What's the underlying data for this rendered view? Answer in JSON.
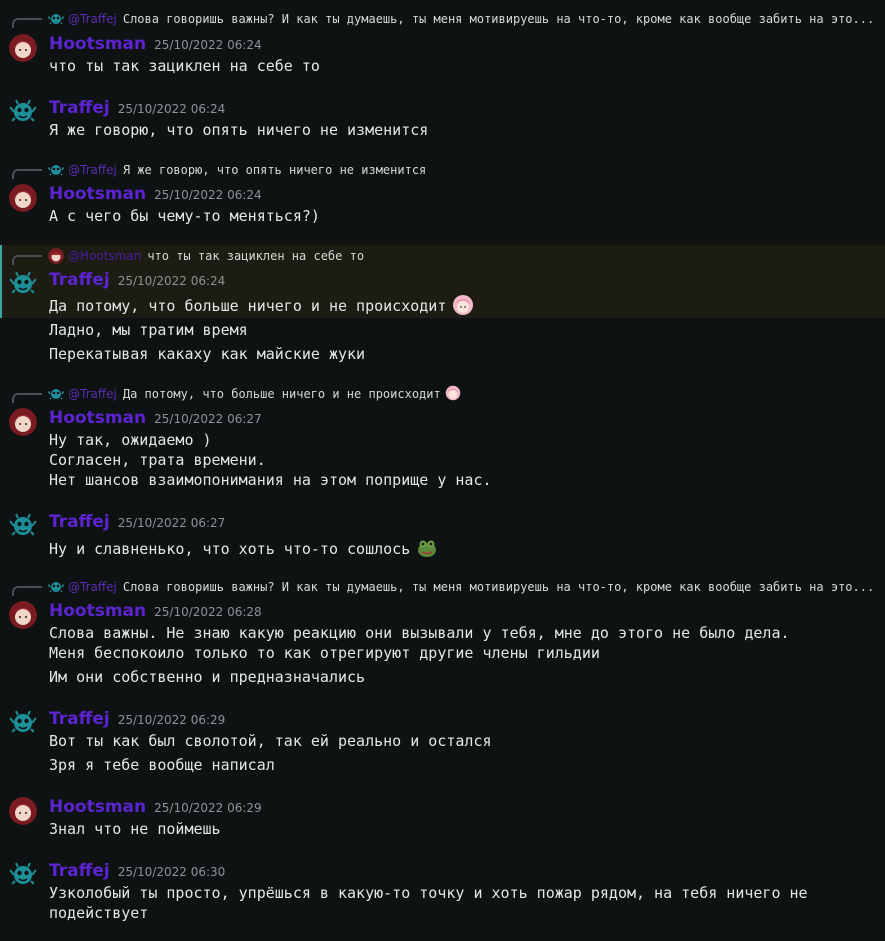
{
  "colors": {
    "background": "#0f1212",
    "username": "#5b24d0",
    "timestamp": "#8e9297",
    "text": "#e4e6e8",
    "highlight_bg": "#1c1c12",
    "highlight_bar": "#3aa6a0"
  },
  "messages": [
    {
      "reply": {
        "user": "@Traffej",
        "text": "Слова говоришь важны? И как ты думаешь, ты меня мотивируешь на что-то, кроме как вообще забить на это..."
      },
      "author": "Hootsman",
      "time": "25/10/2022 06:24",
      "lines": [
        "что ты так зациклен на себе то"
      ]
    },
    {
      "author": "Traffej",
      "time": "25/10/2022 06:24",
      "lines": [
        "Я же говорю, что опять ничего не изменится"
      ]
    },
    {
      "reply": {
        "user": "@Traffej",
        "text": "Я же говорю, что опять ничего не изменится"
      },
      "author": "Hootsman",
      "time": "25/10/2022 06:24",
      "lines": [
        "А с чего бы чему-то меняться?)"
      ]
    },
    {
      "reply": {
        "user": "@Hootsman",
        "text": "что ты так зациклен на себе то"
      },
      "author": "Traffej",
      "time": "25/10/2022 06:24",
      "lines": [
        "Да потому, что больше ничего и не происходит",
        "Ладно, мы тратим время",
        "Перекатывая какаху как майские жуки"
      ]
    },
    {
      "reply": {
        "user": "@Traffej",
        "text": "Да потому, что больше ничего и не происходит"
      },
      "author": "Hootsman",
      "time": "25/10/2022 06:27",
      "lines": [
        "Ну так, ожидаемо )",
        "Согласен, трата времени.",
        "Нет шансов взаимопонимания на этом поприще у нас."
      ]
    },
    {
      "author": "Traffej",
      "time": "25/10/2022 06:27",
      "lines": [
        "Ну и славненько, что хоть что-то сошлось"
      ]
    },
    {
      "reply": {
        "user": "@Traffej",
        "text": "Слова говоришь важны? И как ты думаешь, ты меня мотивируешь на что-то, кроме как вообще забить на это..."
      },
      "author": "Hootsman",
      "time": "25/10/2022 06:28",
      "lines": [
        "Слова важны. Не знаю какую реакцию они вызывали у тебя, мне до этого не было дела.",
        "Меня беспокоило только то как отрегируют другие члены гильдии",
        "Им они собственно и предназначались"
      ]
    },
    {
      "author": "Traffej",
      "time": "25/10/2022 06:29",
      "lines": [
        "Вот ты как был сволотой, так ей реально и остался",
        "Зря я тебе вообще написал"
      ]
    },
    {
      "author": "Hootsman",
      "time": "25/10/2022 06:29",
      "lines": [
        "Знал что не поймешь"
      ]
    },
    {
      "author": "Traffej",
      "time": "25/10/2022 06:30",
      "lines": [
        "Узколобый ты просто, упрёшься в какую-то точку и хоть пожар рядом, на тебя ничего не",
        "подействует"
      ]
    }
  ]
}
